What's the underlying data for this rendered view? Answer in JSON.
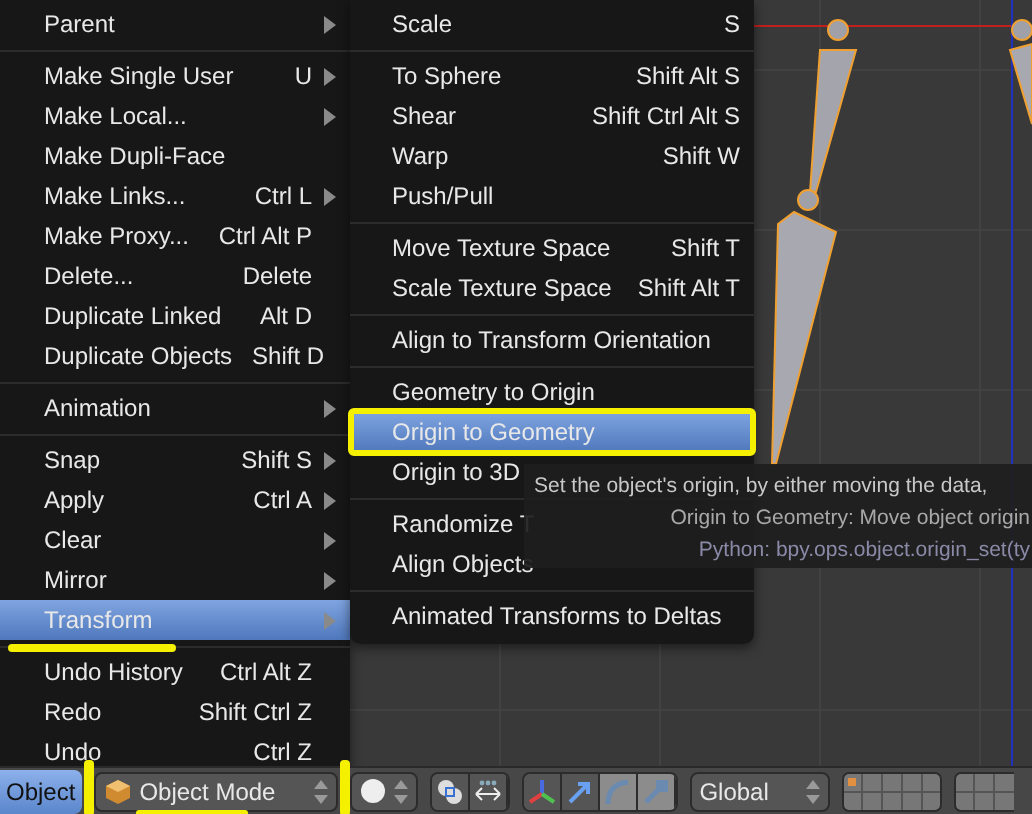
{
  "menu": {
    "items": [
      {
        "kind": "item",
        "label": "Parent",
        "submenu": true,
        "selected": false
      },
      {
        "kind": "separator"
      },
      {
        "kind": "item",
        "label": "Make Single User",
        "shortcut": "U",
        "submenu": true,
        "selected": false
      },
      {
        "kind": "item",
        "label": "Make Local...",
        "submenu": true,
        "selected": false
      },
      {
        "kind": "item",
        "label": "Make Dupli-Face",
        "submenu": false,
        "selected": false
      },
      {
        "kind": "item",
        "label": "Make Links...",
        "shortcut": "Ctrl L",
        "submenu": true,
        "selected": false
      },
      {
        "kind": "item",
        "label": "Make Proxy...",
        "shortcut": "Ctrl Alt P",
        "submenu": false,
        "selected": false
      },
      {
        "kind": "item",
        "label": "Delete...",
        "shortcut": "Delete",
        "submenu": false,
        "selected": false
      },
      {
        "kind": "item",
        "label": "Duplicate Linked",
        "shortcut": "Alt D",
        "submenu": false,
        "selected": false
      },
      {
        "kind": "item",
        "label": "Duplicate Objects",
        "shortcut": "Shift D",
        "submenu": false,
        "selected": false
      },
      {
        "kind": "separator"
      },
      {
        "kind": "item",
        "label": "Animation",
        "submenu": true,
        "selected": false
      },
      {
        "kind": "separator"
      },
      {
        "kind": "item",
        "label": "Snap",
        "shortcut": "Shift S",
        "submenu": true,
        "selected": false
      },
      {
        "kind": "item",
        "label": "Apply",
        "shortcut": "Ctrl A",
        "submenu": true,
        "selected": false
      },
      {
        "kind": "item",
        "label": "Clear",
        "submenu": true,
        "selected": false
      },
      {
        "kind": "item",
        "label": "Mirror",
        "submenu": true,
        "selected": false
      },
      {
        "kind": "item",
        "label": "Transform",
        "submenu": true,
        "selected": true,
        "marked": true
      },
      {
        "kind": "separator"
      },
      {
        "kind": "item",
        "label": "Undo History",
        "shortcut": "Ctrl Alt Z",
        "submenu": false,
        "selected": false
      },
      {
        "kind": "item",
        "label": "Redo",
        "shortcut": "Shift Ctrl Z",
        "submenu": false,
        "selected": false
      },
      {
        "kind": "item",
        "label": "Undo",
        "shortcut": "Ctrl Z",
        "submenu": false,
        "selected": false
      }
    ]
  },
  "submenu": {
    "items": [
      {
        "kind": "item",
        "label": "Scale",
        "shortcut": "S",
        "selected": false
      },
      {
        "kind": "separator"
      },
      {
        "kind": "item",
        "label": "To Sphere",
        "shortcut": "Shift Alt S",
        "selected": false
      },
      {
        "kind": "item",
        "label": "Shear",
        "shortcut": "Shift Ctrl Alt S",
        "selected": false
      },
      {
        "kind": "item",
        "label": "Warp",
        "shortcut": "Shift W",
        "selected": false
      },
      {
        "kind": "item",
        "label": "Push/Pull",
        "selected": false
      },
      {
        "kind": "separator"
      },
      {
        "kind": "item",
        "label": "Move Texture Space",
        "shortcut": "Shift T",
        "selected": false
      },
      {
        "kind": "item",
        "label": "Scale Texture Space",
        "shortcut": "Shift Alt T",
        "selected": false
      },
      {
        "kind": "separator"
      },
      {
        "kind": "item",
        "label": "Align to Transform Orientation",
        "selected": false
      },
      {
        "kind": "separator"
      },
      {
        "kind": "item",
        "label": "Geometry to Origin",
        "selected": false
      },
      {
        "kind": "item",
        "label": "Origin to Geometry",
        "selected": true,
        "marked": true
      },
      {
        "kind": "item",
        "label": "Origin to 3D",
        "selected": false
      },
      {
        "kind": "separator"
      },
      {
        "kind": "item",
        "label": "Randomize T",
        "selected": false
      },
      {
        "kind": "item",
        "label": "Align Objects",
        "selected": false
      },
      {
        "kind": "separator"
      },
      {
        "kind": "item",
        "label": "Animated Transforms to Deltas",
        "selected": false
      }
    ]
  },
  "tooltip": {
    "lines": [
      {
        "kind": "description",
        "text": "Set the object's origin, by either moving the data,"
      },
      {
        "kind": "label",
        "text": "Origin to Geometry: Move object origin"
      },
      {
        "kind": "python",
        "text": "Python: bpy.ops.object.origin_set(ty"
      }
    ]
  },
  "header": {
    "mode_button": {
      "label": "Object",
      "selected": true,
      "marked": true
    },
    "mode_dropdown": {
      "label": "Object Mode",
      "marked": true
    },
    "orientation_dropdown": {
      "label": "Global"
    }
  }
}
